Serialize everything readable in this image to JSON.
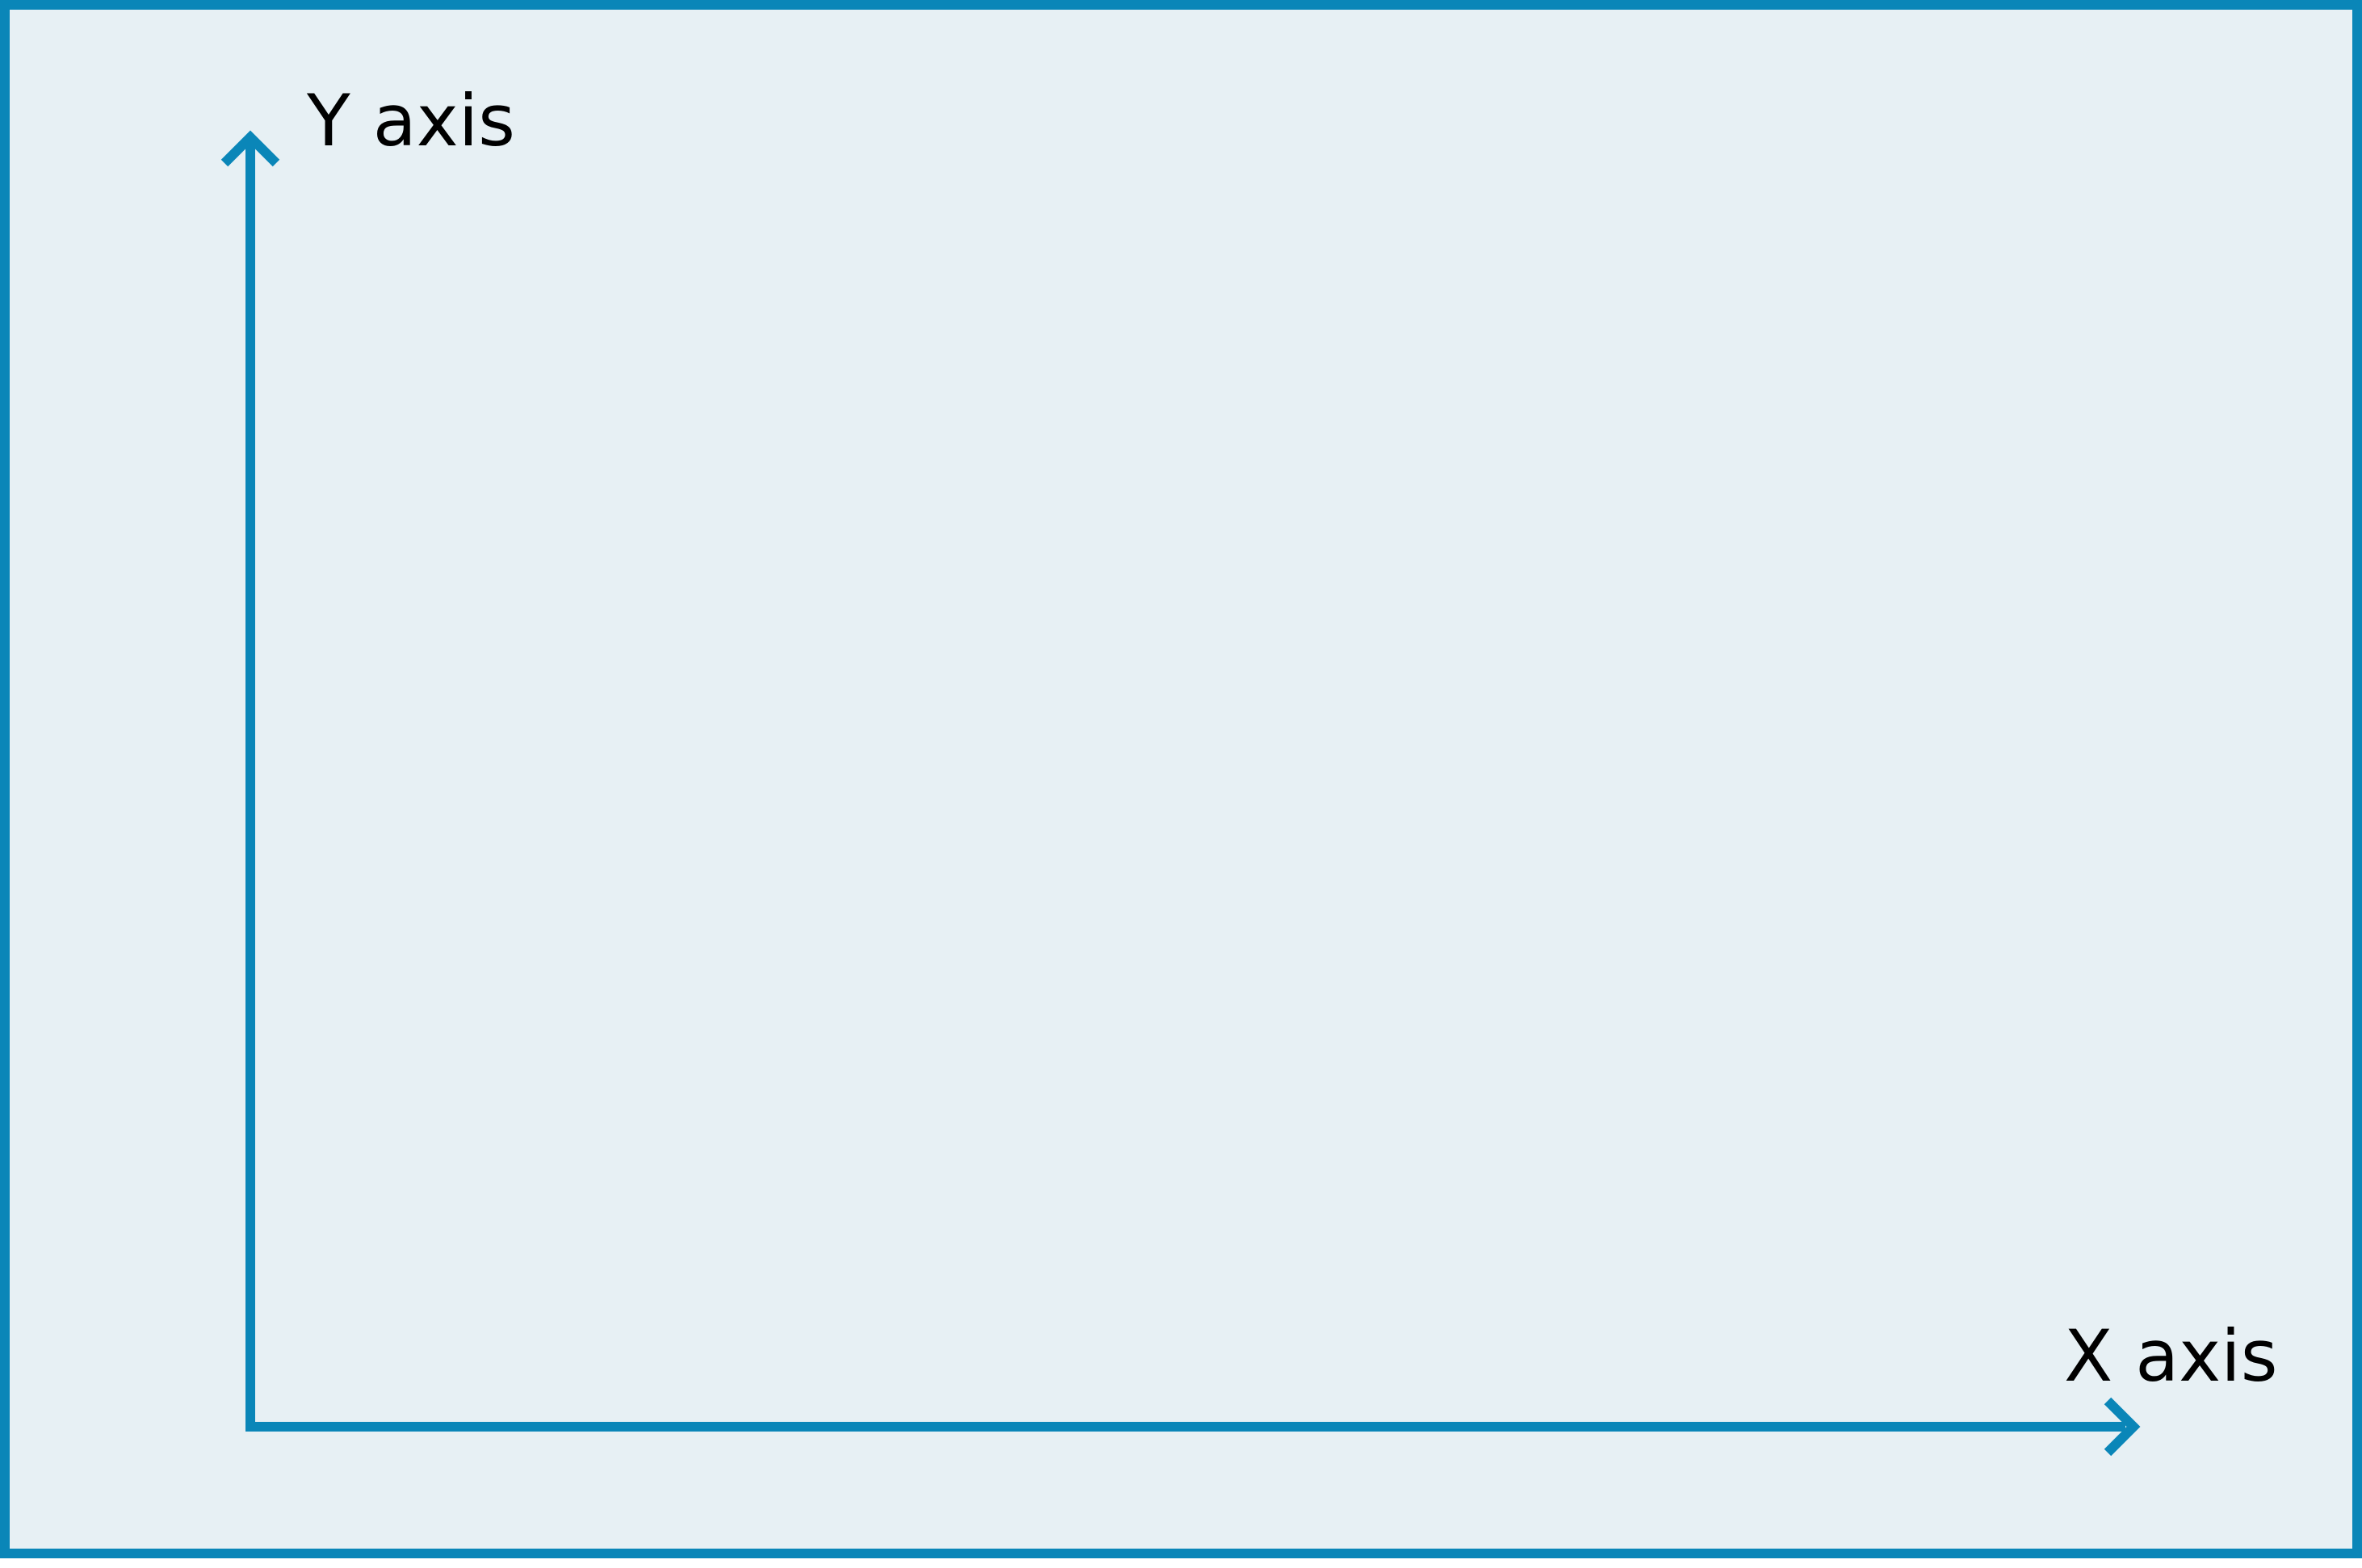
{
  "diagram": {
    "y_axis_label": "Y axis",
    "x_axis_label": "X axis",
    "axis_color": "#0a86b8",
    "frame_color": "#0a86b8",
    "background_color": "#e7f0f4",
    "label_color": "#000000"
  }
}
